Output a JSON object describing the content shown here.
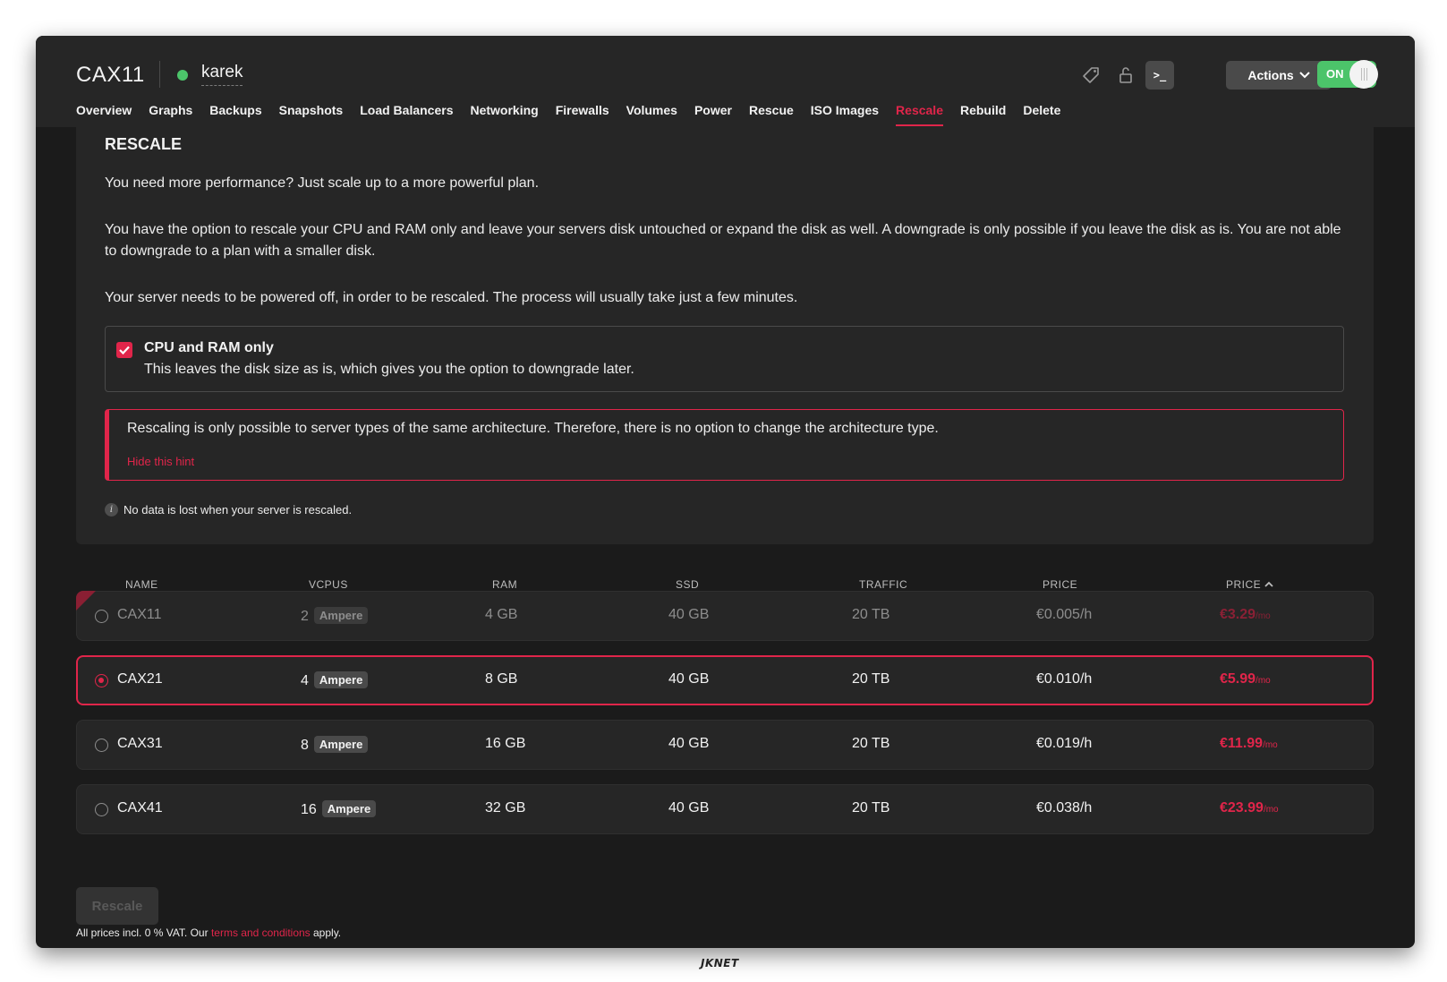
{
  "header": {
    "server_type": "CAX11",
    "hostname": "karek",
    "status_color": "#4cc46a",
    "console_label": ">_",
    "actions_label": "Actions",
    "power_toggle_label": "ON"
  },
  "tabs": [
    {
      "label": "Overview",
      "active": false
    },
    {
      "label": "Graphs",
      "active": false
    },
    {
      "label": "Backups",
      "active": false
    },
    {
      "label": "Snapshots",
      "active": false
    },
    {
      "label": "Load Balancers",
      "active": false
    },
    {
      "label": "Networking",
      "active": false
    },
    {
      "label": "Firewalls",
      "active": false
    },
    {
      "label": "Volumes",
      "active": false
    },
    {
      "label": "Power",
      "active": false
    },
    {
      "label": "Rescue",
      "active": false
    },
    {
      "label": "ISO Images",
      "active": false
    },
    {
      "label": "Rescale",
      "active": true
    },
    {
      "label": "Rebuild",
      "active": false
    },
    {
      "label": "Delete",
      "active": false
    }
  ],
  "rescale": {
    "title": "RESCALE",
    "intro": "You need more performance? Just scale up to a more powerful plan.",
    "options_text": "You have the option to rescale your CPU and RAM only and leave your servers disk untouched or expand the disk as well. A downgrade is only possible if you leave the disk as is. You are not able to downgrade to a plan with a smaller disk.",
    "power_text": "Your server needs to be powered off, in order to be rescaled. The process will usually take just a few minutes.",
    "cpu_ram_option": {
      "checked": true,
      "title": "CPU and RAM only",
      "description": "This leaves the disk size as is, which gives you the option to downgrade later."
    },
    "hint": {
      "text": "Rescaling is only possible to server types of the same architecture. Therefore, there is no option to change the architecture type.",
      "hide_label": "Hide this hint"
    },
    "info_icon": "i",
    "info_text": "No data is lost when your server is rescaled."
  },
  "table": {
    "columns": [
      "NAME",
      "VCPUS",
      "RAM",
      "SSD",
      "TRAFFIC",
      "PRICE",
      "PRICE"
    ],
    "sort_icon": "chevron-up-icon",
    "rows": [
      {
        "name": "CAX11",
        "vcpus": "2",
        "arch": "Ampere",
        "ram": "4 GB",
        "ssd": "40 GB",
        "traffic": "20 TB",
        "price_h": "€0.005/h",
        "price_mo": "€3.29",
        "mo_unit": "/mo",
        "state": "current"
      },
      {
        "name": "CAX21",
        "vcpus": "4",
        "arch": "Ampere",
        "ram": "8 GB",
        "ssd": "40 GB",
        "traffic": "20 TB",
        "price_h": "€0.010/h",
        "price_mo": "€5.99",
        "mo_unit": "/mo",
        "state": "selected"
      },
      {
        "name": "CAX31",
        "vcpus": "8",
        "arch": "Ampere",
        "ram": "16 GB",
        "ssd": "40 GB",
        "traffic": "20 TB",
        "price_h": "€0.019/h",
        "price_mo": "€11.99",
        "mo_unit": "/mo",
        "state": "available"
      },
      {
        "name": "CAX41",
        "vcpus": "16",
        "arch": "Ampere",
        "ram": "32 GB",
        "ssd": "40 GB",
        "traffic": "20 TB",
        "price_h": "€0.038/h",
        "price_mo": "€23.99",
        "mo_unit": "/mo",
        "state": "available"
      }
    ]
  },
  "footer": {
    "rescale_button": "Rescale",
    "note_prefix": "All prices incl. 0 % VAT. Our ",
    "note_link": "terms and conditions",
    "note_suffix": " apply."
  },
  "watermark": "JKNET",
  "colors": {
    "accent": "#e0254a",
    "status_on": "#4cc46a",
    "background": "#1b1b1b",
    "panel": "#262626"
  }
}
